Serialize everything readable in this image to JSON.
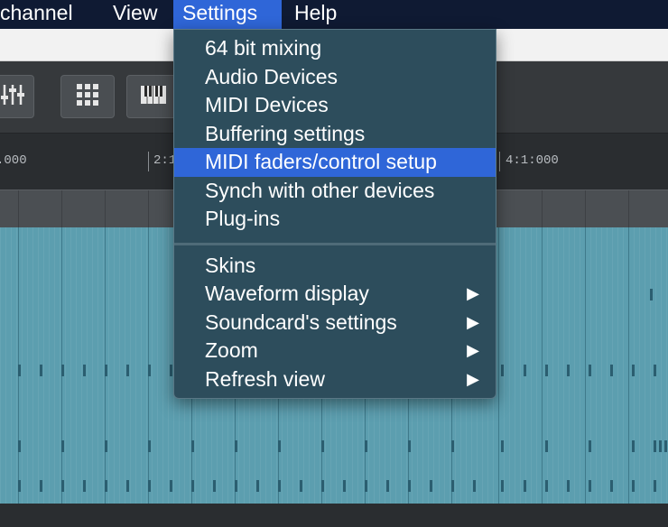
{
  "menubar": {
    "items": [
      "channel",
      "View",
      "Settings",
      "Help"
    ],
    "active": "Settings"
  },
  "ruler": {
    "labels": [
      ".000",
      "2:1",
      "4:1:000"
    ]
  },
  "settings_menu": {
    "group1": [
      "64 bit mixing",
      "Audio Devices",
      "MIDI Devices",
      "Buffering settings",
      "MIDI faders/control setup",
      "Synch with other devices",
      "Plug-ins"
    ],
    "highlighted": "MIDI faders/control setup",
    "group2": [
      {
        "label": "Skins",
        "submenu": false
      },
      {
        "label": "Waveform display",
        "submenu": true
      },
      {
        "label": "Soundcard's settings",
        "submenu": true
      },
      {
        "label": "Zoom",
        "submenu": true
      },
      {
        "label": "Refresh view",
        "submenu": true
      }
    ],
    "submenu_arrow": "▶"
  },
  "toolbar": {
    "icons": [
      "mixer-faders-icon",
      "grid-pads-icon",
      "piano-keyboard-icon"
    ]
  },
  "colors": {
    "menubar_bg": "#0f1a33",
    "highlight": "#2f66d8",
    "dropdown_bg": "#2d4d5c",
    "track_bg": "#5c9eaf"
  }
}
